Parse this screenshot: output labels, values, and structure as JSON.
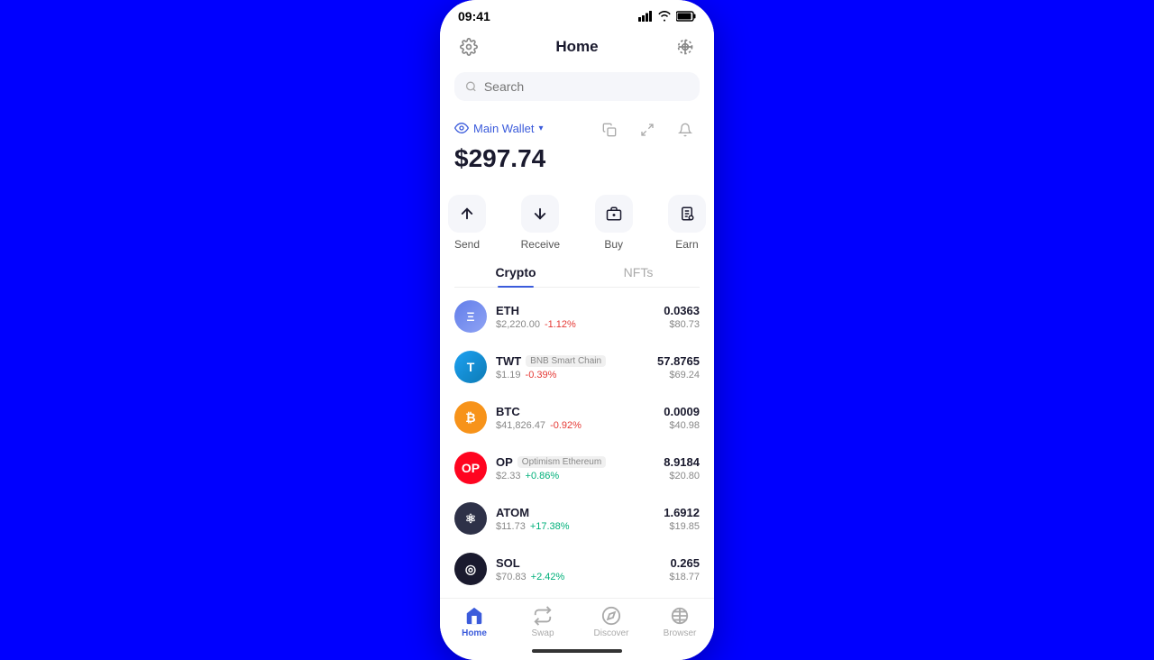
{
  "statusBar": {
    "time": "09:41"
  },
  "header": {
    "title": "Home"
  },
  "search": {
    "placeholder": "Search"
  },
  "wallet": {
    "name": "Main Wallet",
    "balance": "$297.74"
  },
  "actions": [
    {
      "id": "send",
      "label": "Send"
    },
    {
      "id": "receive",
      "label": "Receive"
    },
    {
      "id": "buy",
      "label": "Buy"
    },
    {
      "id": "earn",
      "label": "Earn"
    }
  ],
  "tabs": [
    {
      "id": "crypto",
      "label": "Crypto",
      "active": true
    },
    {
      "id": "nfts",
      "label": "NFTs",
      "active": false
    }
  ],
  "cryptoList": [
    {
      "symbol": "ETH",
      "chain": "",
      "price": "$2,220.00",
      "change": "-1.12%",
      "changeType": "neg",
      "amount": "0.0363",
      "value": "$80.73",
      "logoClass": "eth-logo",
      "logoText": "Ξ"
    },
    {
      "symbol": "TWT",
      "chain": "BNB Smart Chain",
      "price": "$1.19",
      "change": "-0.39%",
      "changeType": "neg",
      "amount": "57.8765",
      "value": "$69.24",
      "logoClass": "twt-logo",
      "logoText": "T"
    },
    {
      "symbol": "BTC",
      "chain": "",
      "price": "$41,826.47",
      "change": "-0.92%",
      "changeType": "neg",
      "amount": "0.0009",
      "value": "$40.98",
      "logoClass": "btc-logo",
      "logoText": "₿"
    },
    {
      "symbol": "OP",
      "chain": "Optimism Ethereum",
      "price": "$2.33",
      "change": "+0.86%",
      "changeType": "pos",
      "amount": "8.9184",
      "value": "$20.80",
      "logoClass": "op-logo",
      "logoText": "OP"
    },
    {
      "symbol": "ATOM",
      "chain": "",
      "price": "$11.73",
      "change": "+17.38%",
      "changeType": "pos",
      "amount": "1.6912",
      "value": "$19.85",
      "logoClass": "atom-logo",
      "logoText": "⚛"
    },
    {
      "symbol": "SOL",
      "chain": "",
      "price": "$70.83",
      "change": "+2.42%",
      "changeType": "pos",
      "amount": "0.265",
      "value": "$18.77",
      "logoClass": "sol-logo",
      "logoText": "◎"
    }
  ],
  "bottomNav": [
    {
      "id": "home",
      "label": "Home",
      "active": true
    },
    {
      "id": "swap",
      "label": "Swap",
      "active": false
    },
    {
      "id": "discover",
      "label": "Discover",
      "active": false
    },
    {
      "id": "browser",
      "label": "Browser",
      "active": false
    }
  ]
}
